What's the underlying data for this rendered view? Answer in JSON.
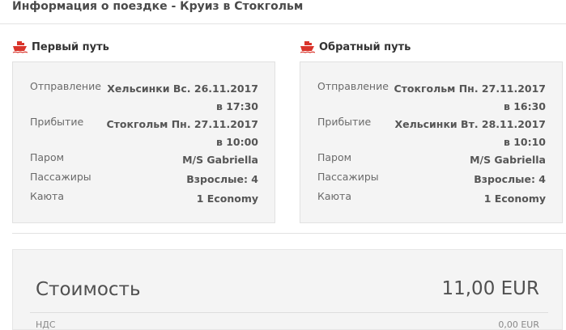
{
  "page": {
    "title": "Информация о поездке - Круиз в Стокгольм"
  },
  "outbound": {
    "title": "Первый путь",
    "icon": "ferry-icon",
    "rows": [
      {
        "label": "Отправление",
        "value": "Хельсинки Вс. 26.11.2017 в 17:30"
      },
      {
        "label": "Прибытие",
        "value": "Стокгольм Пн. 27.11.2017 в 10:00"
      },
      {
        "label": "Паром",
        "value": "M/S Gabriella"
      },
      {
        "label": "Пассажиры",
        "value": "Взрослые: 4"
      },
      {
        "label": "Каюта",
        "value": "1 Economy"
      }
    ]
  },
  "return": {
    "title": "Обратный путь",
    "icon": "ferry-icon",
    "rows": [
      {
        "label": "Отправление",
        "value": "Стокгольм Пн. 27.11.2017 в 16:30"
      },
      {
        "label": "Прибытие",
        "value": "Хельсинки Вт. 28.11.2017 в 10:10"
      },
      {
        "label": "Паром",
        "value": "M/S Gabriella"
      },
      {
        "label": "Пассажиры",
        "value": "Взрослые: 4"
      },
      {
        "label": "Каюта",
        "value": "1 Economy"
      }
    ]
  },
  "cost": {
    "label": "Стоимость",
    "value": "11,00 EUR",
    "sub_label": "НДС",
    "sub_value": "0,00 EUR"
  },
  "colors": {
    "accent": "#d9342b",
    "panel_bg": "#f4f4f4"
  }
}
